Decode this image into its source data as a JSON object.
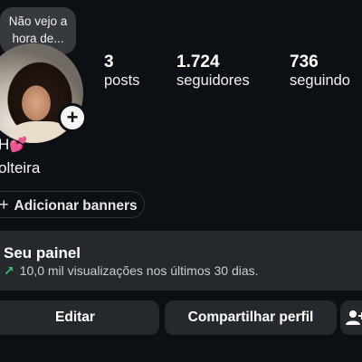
{
  "note": {
    "text": "Não vejo a hora de..."
  },
  "stats": [
    {
      "value": "3",
      "label": "posts"
    },
    {
      "value": "1.724",
      "label": "seguidores"
    },
    {
      "value": "736",
      "label": "seguindo"
    }
  ],
  "bio": {
    "name": "H",
    "line2": "olteira"
  },
  "banners": {
    "label": "Adicionar banners"
  },
  "panel": {
    "title": "Seu painel",
    "subtitle": "10,0 mil visualizações nos últimos 30 dias."
  },
  "actions": {
    "edit": "Editar",
    "share": "Compartilhar perfil"
  },
  "icons": {
    "add_story": "plus-icon",
    "heart": "two-hearts-icon",
    "trend": "trend-up-icon",
    "add_person": "add-person-icon"
  },
  "colors": {
    "background": "#0c1014",
    "panel": "#25292e",
    "trend": "#33c46d",
    "heart": "#ff6fa8"
  }
}
